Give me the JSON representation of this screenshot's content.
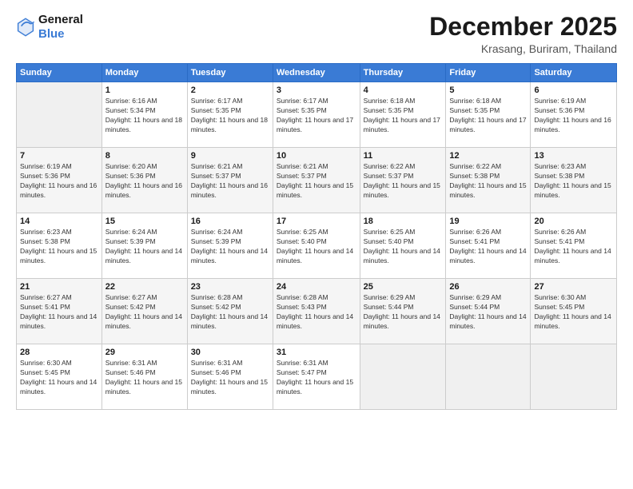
{
  "logo": {
    "line1": "General",
    "line2": "Blue"
  },
  "title": "December 2025",
  "location": "Krasang, Buriram, Thailand",
  "days_of_week": [
    "Sunday",
    "Monday",
    "Tuesday",
    "Wednesday",
    "Thursday",
    "Friday",
    "Saturday"
  ],
  "weeks": [
    [
      {
        "day": "",
        "sunrise": "",
        "sunset": "",
        "daylight": ""
      },
      {
        "day": "1",
        "sunrise": "Sunrise: 6:16 AM",
        "sunset": "Sunset: 5:34 PM",
        "daylight": "Daylight: 11 hours and 18 minutes."
      },
      {
        "day": "2",
        "sunrise": "Sunrise: 6:17 AM",
        "sunset": "Sunset: 5:35 PM",
        "daylight": "Daylight: 11 hours and 18 minutes."
      },
      {
        "day": "3",
        "sunrise": "Sunrise: 6:17 AM",
        "sunset": "Sunset: 5:35 PM",
        "daylight": "Daylight: 11 hours and 17 minutes."
      },
      {
        "day": "4",
        "sunrise": "Sunrise: 6:18 AM",
        "sunset": "Sunset: 5:35 PM",
        "daylight": "Daylight: 11 hours and 17 minutes."
      },
      {
        "day": "5",
        "sunrise": "Sunrise: 6:18 AM",
        "sunset": "Sunset: 5:35 PM",
        "daylight": "Daylight: 11 hours and 17 minutes."
      },
      {
        "day": "6",
        "sunrise": "Sunrise: 6:19 AM",
        "sunset": "Sunset: 5:36 PM",
        "daylight": "Daylight: 11 hours and 16 minutes."
      }
    ],
    [
      {
        "day": "7",
        "sunrise": "Sunrise: 6:19 AM",
        "sunset": "Sunset: 5:36 PM",
        "daylight": "Daylight: 11 hours and 16 minutes."
      },
      {
        "day": "8",
        "sunrise": "Sunrise: 6:20 AM",
        "sunset": "Sunset: 5:36 PM",
        "daylight": "Daylight: 11 hours and 16 minutes."
      },
      {
        "day": "9",
        "sunrise": "Sunrise: 6:21 AM",
        "sunset": "Sunset: 5:37 PM",
        "daylight": "Daylight: 11 hours and 16 minutes."
      },
      {
        "day": "10",
        "sunrise": "Sunrise: 6:21 AM",
        "sunset": "Sunset: 5:37 PM",
        "daylight": "Daylight: 11 hours and 15 minutes."
      },
      {
        "day": "11",
        "sunrise": "Sunrise: 6:22 AM",
        "sunset": "Sunset: 5:37 PM",
        "daylight": "Daylight: 11 hours and 15 minutes."
      },
      {
        "day": "12",
        "sunrise": "Sunrise: 6:22 AM",
        "sunset": "Sunset: 5:38 PM",
        "daylight": "Daylight: 11 hours and 15 minutes."
      },
      {
        "day": "13",
        "sunrise": "Sunrise: 6:23 AM",
        "sunset": "Sunset: 5:38 PM",
        "daylight": "Daylight: 11 hours and 15 minutes."
      }
    ],
    [
      {
        "day": "14",
        "sunrise": "Sunrise: 6:23 AM",
        "sunset": "Sunset: 5:38 PM",
        "daylight": "Daylight: 11 hours and 15 minutes."
      },
      {
        "day": "15",
        "sunrise": "Sunrise: 6:24 AM",
        "sunset": "Sunset: 5:39 PM",
        "daylight": "Daylight: 11 hours and 14 minutes."
      },
      {
        "day": "16",
        "sunrise": "Sunrise: 6:24 AM",
        "sunset": "Sunset: 5:39 PM",
        "daylight": "Daylight: 11 hours and 14 minutes."
      },
      {
        "day": "17",
        "sunrise": "Sunrise: 6:25 AM",
        "sunset": "Sunset: 5:40 PM",
        "daylight": "Daylight: 11 hours and 14 minutes."
      },
      {
        "day": "18",
        "sunrise": "Sunrise: 6:25 AM",
        "sunset": "Sunset: 5:40 PM",
        "daylight": "Daylight: 11 hours and 14 minutes."
      },
      {
        "day": "19",
        "sunrise": "Sunrise: 6:26 AM",
        "sunset": "Sunset: 5:41 PM",
        "daylight": "Daylight: 11 hours and 14 minutes."
      },
      {
        "day": "20",
        "sunrise": "Sunrise: 6:26 AM",
        "sunset": "Sunset: 5:41 PM",
        "daylight": "Daylight: 11 hours and 14 minutes."
      }
    ],
    [
      {
        "day": "21",
        "sunrise": "Sunrise: 6:27 AM",
        "sunset": "Sunset: 5:41 PM",
        "daylight": "Daylight: 11 hours and 14 minutes."
      },
      {
        "day": "22",
        "sunrise": "Sunrise: 6:27 AM",
        "sunset": "Sunset: 5:42 PM",
        "daylight": "Daylight: 11 hours and 14 minutes."
      },
      {
        "day": "23",
        "sunrise": "Sunrise: 6:28 AM",
        "sunset": "Sunset: 5:42 PM",
        "daylight": "Daylight: 11 hours and 14 minutes."
      },
      {
        "day": "24",
        "sunrise": "Sunrise: 6:28 AM",
        "sunset": "Sunset: 5:43 PM",
        "daylight": "Daylight: 11 hours and 14 minutes."
      },
      {
        "day": "25",
        "sunrise": "Sunrise: 6:29 AM",
        "sunset": "Sunset: 5:44 PM",
        "daylight": "Daylight: 11 hours and 14 minutes."
      },
      {
        "day": "26",
        "sunrise": "Sunrise: 6:29 AM",
        "sunset": "Sunset: 5:44 PM",
        "daylight": "Daylight: 11 hours and 14 minutes."
      },
      {
        "day": "27",
        "sunrise": "Sunrise: 6:30 AM",
        "sunset": "Sunset: 5:45 PM",
        "daylight": "Daylight: 11 hours and 14 minutes."
      }
    ],
    [
      {
        "day": "28",
        "sunrise": "Sunrise: 6:30 AM",
        "sunset": "Sunset: 5:45 PM",
        "daylight": "Daylight: 11 hours and 14 minutes."
      },
      {
        "day": "29",
        "sunrise": "Sunrise: 6:31 AM",
        "sunset": "Sunset: 5:46 PM",
        "daylight": "Daylight: 11 hours and 15 minutes."
      },
      {
        "day": "30",
        "sunrise": "Sunrise: 6:31 AM",
        "sunset": "Sunset: 5:46 PM",
        "daylight": "Daylight: 11 hours and 15 minutes."
      },
      {
        "day": "31",
        "sunrise": "Sunrise: 6:31 AM",
        "sunset": "Sunset: 5:47 PM",
        "daylight": "Daylight: 11 hours and 15 minutes."
      },
      {
        "day": "",
        "sunrise": "",
        "sunset": "",
        "daylight": ""
      },
      {
        "day": "",
        "sunrise": "",
        "sunset": "",
        "daylight": ""
      },
      {
        "day": "",
        "sunrise": "",
        "sunset": "",
        "daylight": ""
      }
    ]
  ]
}
